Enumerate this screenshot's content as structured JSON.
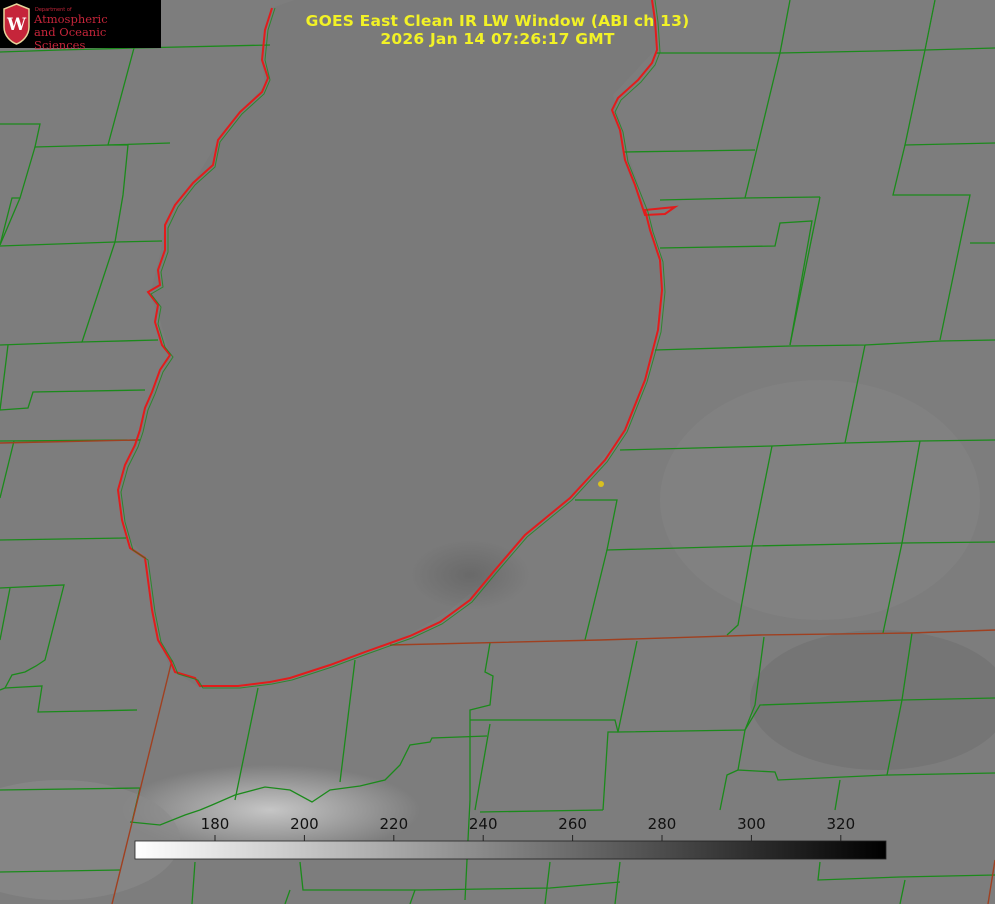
{
  "title": {
    "line1": "GOES East Clean IR LW Window (ABI ch 13)",
    "line2": "2026 Jan 14 07:26:17 GMT"
  },
  "logo": {
    "department": "Department of",
    "line1": "Atmospheric",
    "line2": "and Oceanic Sciences",
    "crest_letter": "W",
    "crest_color": "#c5253a"
  },
  "colorbar": {
    "ticks": [
      "180",
      "200",
      "220",
      "240",
      "260",
      "280",
      "300",
      "320"
    ],
    "min": 162,
    "max": 310,
    "low_color": "#ffffff",
    "high_color": "#000000"
  },
  "colors": {
    "title": "#f2f226",
    "lake_outline": "#e21c1c",
    "county_lines": "#1b8a1b",
    "state_lines": "#a04020",
    "marker": "#d8c020"
  }
}
